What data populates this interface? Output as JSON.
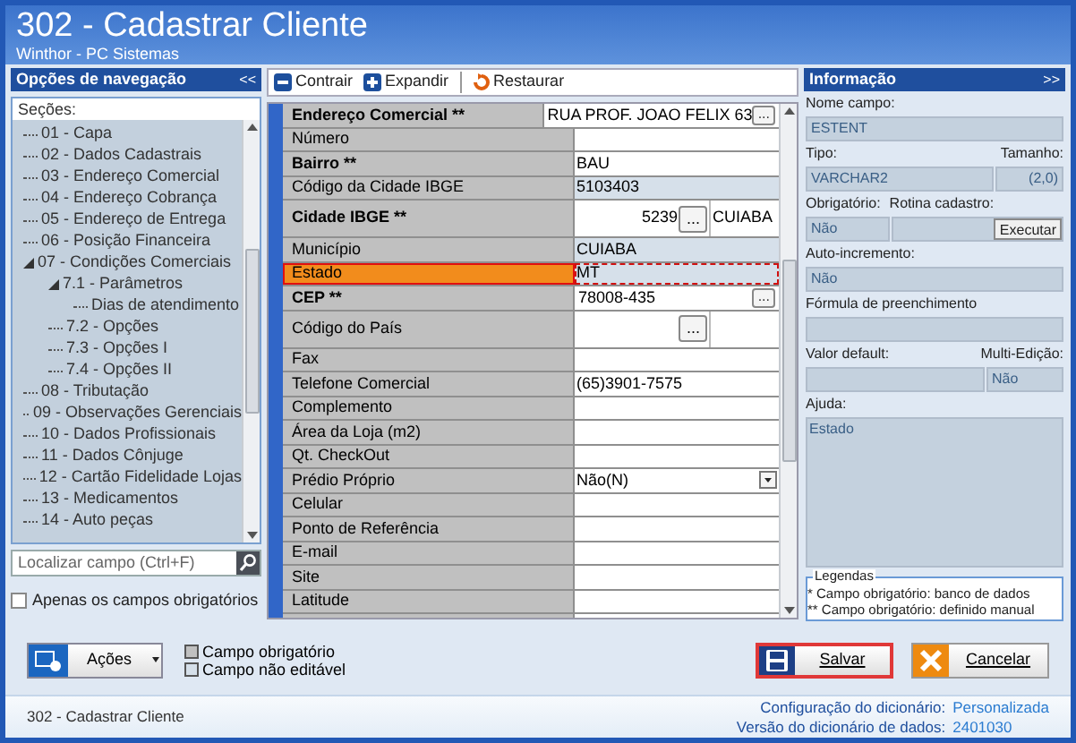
{
  "window": {
    "title": "302 - Cadastrar Cliente",
    "subtitle": "Winthor - PC Sistemas"
  },
  "nav": {
    "title": "Opções de navegação",
    "collapse": "<<",
    "sections_label": "Seções:",
    "tree": [
      {
        "label": "01 - Capa"
      },
      {
        "label": "02 - Dados Cadastrais"
      },
      {
        "label": "03 - Endereço Comercial"
      },
      {
        "label": "04 - Endereço Cobrança"
      },
      {
        "label": "05 - Endereço de Entrega"
      },
      {
        "label": "06 - Posição Financeira"
      },
      {
        "label": "07 - Condições Comerciais",
        "expanded": true,
        "children": [
          {
            "label": "7.1 - Parâmetros",
            "expanded": true,
            "children": [
              {
                "label": "Dias de atendimento"
              }
            ]
          },
          {
            "label": "7.2 - Opções"
          },
          {
            "label": "7.3 - Opções I"
          },
          {
            "label": "7.4 - Opções II"
          }
        ]
      },
      {
        "label": "08 - Tributação"
      },
      {
        "label": "09 - Observações Gerenciais"
      },
      {
        "label": "10 - Dados Profissionais"
      },
      {
        "label": "11 - Dados Cônjuge"
      },
      {
        "label": "12 - Cartão Fidelidade Lojas"
      },
      {
        "label": "13 - Medicamentos"
      },
      {
        "label": "14 - Auto peças"
      }
    ],
    "search": {
      "placeholder": "Localizar campo (Ctrl+F)"
    },
    "only_required": {
      "label": "Apenas os campos obrigatórios",
      "checked": false
    }
  },
  "toolbar": [
    {
      "label": "Contrair",
      "kind": "collapse"
    },
    {
      "label": "Expandir",
      "kind": "expand"
    },
    {
      "label": "Restaurar",
      "kind": "restore"
    }
  ],
  "fields": [
    {
      "label": "Endereço Comercial **",
      "required": true,
      "editable": true,
      "selected": false,
      "kind": "lookup",
      "value": "RUA PROF. JOAO FELIX 63",
      "button": "..."
    },
    {
      "label": "Número",
      "required": false,
      "editable": true,
      "selected": false,
      "kind": "text"
    },
    {
      "label": "Bairro **",
      "required": true,
      "editable": true,
      "selected": false,
      "kind": "text",
      "value": "BAU"
    },
    {
      "label": "Código da Cidade IBGE",
      "required": false,
      "editable": false,
      "selected": false,
      "kind": "text",
      "value": "5103403"
    },
    {
      "label": "Cidade IBGE **",
      "required": true,
      "editable": true,
      "selected": false,
      "kind": "city",
      "value": "5239",
      "button": "...",
      "name": "CUIABA"
    },
    {
      "label": "Município",
      "required": false,
      "editable": false,
      "selected": false,
      "kind": "text",
      "value": "CUIABA"
    },
    {
      "label": "Estado",
      "required": false,
      "editable": false,
      "selected": true,
      "kind": "text",
      "value": "MT"
    },
    {
      "label": "CEP **",
      "required": true,
      "editable": true,
      "selected": false,
      "kind": "lookup",
      "value": "78008-435",
      "button": "..."
    },
    {
      "label": "Código do País",
      "required": false,
      "editable": true,
      "selected": false,
      "kind": "city",
      "button": "..."
    },
    {
      "label": "Fax",
      "required": false,
      "editable": true,
      "selected": false,
      "kind": "text"
    },
    {
      "label": "Telefone Comercial",
      "required": false,
      "editable": true,
      "selected": false,
      "kind": "text",
      "value": "(65)3901-7575"
    },
    {
      "label": "Complemento",
      "required": false,
      "editable": true,
      "selected": false,
      "kind": "text"
    },
    {
      "label": "Área da Loja (m2)",
      "required": false,
      "editable": true,
      "selected": false,
      "kind": "text"
    },
    {
      "label": "Qt. CheckOut",
      "required": false,
      "editable": true,
      "selected": false,
      "kind": "text"
    },
    {
      "label": "Prédio Próprio",
      "required": false,
      "editable": true,
      "selected": false,
      "kind": "select",
      "value": "Não(N)"
    },
    {
      "label": "Celular",
      "required": false,
      "editable": true,
      "selected": false,
      "kind": "text"
    },
    {
      "label": "Ponto de Referência",
      "required": false,
      "editable": true,
      "selected": false,
      "kind": "text"
    },
    {
      "label": "E-mail",
      "required": false,
      "editable": true,
      "selected": false,
      "kind": "text"
    },
    {
      "label": "Site",
      "required": false,
      "editable": true,
      "selected": false,
      "kind": "text"
    },
    {
      "label": "Latitude",
      "required": false,
      "editable": true,
      "selected": false,
      "kind": "text"
    }
  ],
  "info": {
    "title": "Informação",
    "expand": ">>",
    "field_name": {
      "label": "Nome campo:",
      "value": "ESTENT"
    },
    "type": {
      "label": "Tipo:",
      "value": "VARCHAR2"
    },
    "size": {
      "label": "Tamanho:",
      "value": "(2,0)"
    },
    "required": {
      "label": "Obrigatório:",
      "value": "Não"
    },
    "routine": {
      "label": "Rotina cadastro:",
      "button": "Executar"
    },
    "auto_increment": {
      "label": "Auto-incremento:",
      "value": "Não"
    },
    "formula": {
      "label": "Fórmula de preenchimento"
    },
    "default": {
      "label": "Valor default:"
    },
    "multi_edit": {
      "label": "Multi-Edição:",
      "value": "Não"
    },
    "help": {
      "label": "Ajuda:",
      "value": "Estado"
    },
    "legend": {
      "title": "Legendas",
      "lines": [
        "* Campo obrigatório: banco de dados",
        "** Campo obrigatório: definido manual"
      ]
    }
  },
  "bottom": {
    "actions": "Ações",
    "legend": [
      {
        "label": "Campo obrigatório",
        "kind": "required"
      },
      {
        "label": "Campo não editável",
        "kind": "readonly"
      }
    ],
    "save": "Salvar",
    "cancel": "Cancelar"
  },
  "status": {
    "left": "302 - Cadastrar Cliente",
    "config_label": "Configuração do dicionário:",
    "config_value": "Personalizada",
    "version_label": "Versão do dicionário de dados:",
    "version_value": "2401030"
  }
}
